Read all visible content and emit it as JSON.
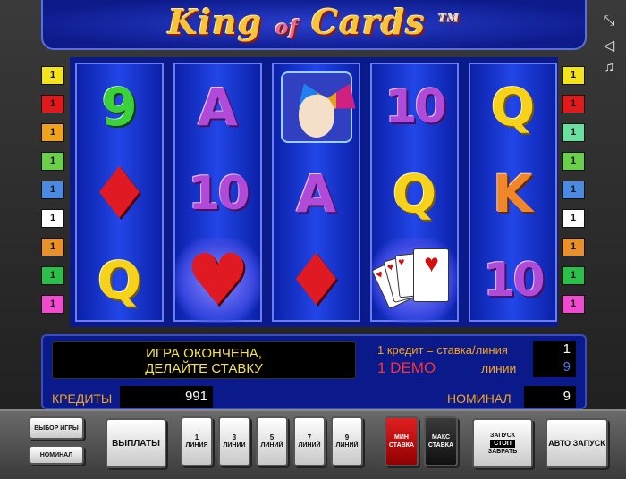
{
  "title": {
    "part1": "King",
    "part2": "of",
    "part3": "Cards",
    "tm": "TM"
  },
  "side_icons": [
    "fullscreen-icon",
    "sound-icon",
    "music-icon"
  ],
  "side_icon_glyphs": {
    "fullscreen": "⤡",
    "sound": "◁",
    "music": "♫"
  },
  "line_numbers": {
    "left": [
      {
        "label": "1",
        "color": "#f4e21a"
      },
      {
        "label": "1",
        "color": "#e01a1a"
      },
      {
        "label": "1",
        "color": "#f0a21a"
      },
      {
        "label": "1",
        "color": "#6ad04a"
      },
      {
        "label": "1",
        "color": "#4a8ae0"
      },
      {
        "label": "1",
        "color": "#ffffff"
      },
      {
        "label": "1",
        "color": "#e8902a"
      },
      {
        "label": "1",
        "color": "#2ac04a"
      },
      {
        "label": "1",
        "color": "#f04ad0"
      }
    ],
    "right": [
      {
        "label": "1",
        "color": "#f4e21a"
      },
      {
        "label": "1",
        "color": "#e01a1a"
      },
      {
        "label": "1",
        "color": "#6ae0a0"
      },
      {
        "label": "1",
        "color": "#6ad04a"
      },
      {
        "label": "1",
        "color": "#4a8ae0"
      },
      {
        "label": "1",
        "color": "#ffffff"
      },
      {
        "label": "1",
        "color": "#e8902a"
      },
      {
        "label": "1",
        "color": "#2ac04a"
      },
      {
        "label": "1",
        "color": "#f04ad0"
      }
    ]
  },
  "reels": [
    [
      "9",
      "diamond",
      "Q"
    ],
    [
      "A",
      "10",
      "heart"
    ],
    [
      "joker",
      "A",
      "diamond"
    ],
    [
      "10",
      "Q",
      "cards"
    ],
    [
      "Q",
      "K",
      "10"
    ]
  ],
  "symbols": {
    "diamond": "♦",
    "heart": "♥",
    "card_glyph": "♥"
  },
  "info": {
    "message_line1": "ИГРА ОКОНЧЕНА,",
    "message_line2": "ДЕЛАЙТЕ СТАВКУ",
    "credit_rate_label": "1 кредит = ставка/линия",
    "credit_rate_value": "1",
    "demo_label": "1 DEMO",
    "lines_label": "линии",
    "lines_value": "9",
    "credits_label": "КРЕДИТЫ",
    "credits_value": "991",
    "nominal_label": "НОМИНАЛ",
    "nominal_value": "9"
  },
  "buttons": {
    "select_game": "ВЫБОР ИГРЫ",
    "nominal": "НОМИНАЛ",
    "payouts": "ВЫПЛАТЫ",
    "lines": [
      {
        "num": "1",
        "label": "ЛИНИЯ"
      },
      {
        "num": "3",
        "label": "ЛИНИИ"
      },
      {
        "num": "5",
        "label": "ЛИНИЙ"
      },
      {
        "num": "7",
        "label": "ЛИНИЙ"
      },
      {
        "num": "9",
        "label": "ЛИНИЙ"
      }
    ],
    "min_bet": "МИН СТАВКА",
    "max_bet": "МАКС СТАВКА",
    "start": "ЗАПУСК",
    "stop": "СТОП",
    "take": "ЗАБРАТЬ",
    "autostart": "АВТО ЗАПУСК"
  }
}
